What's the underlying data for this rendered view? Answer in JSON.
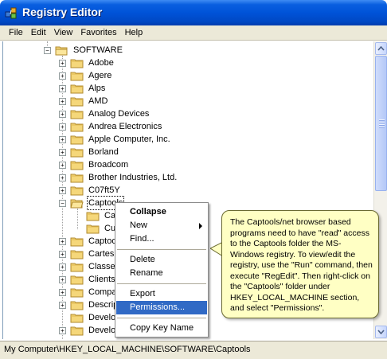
{
  "window": {
    "title": "Registry Editor"
  },
  "menu": [
    "File",
    "Edit",
    "View",
    "Favorites",
    "Help"
  ],
  "tree": {
    "root": "SOFTWARE",
    "items": [
      {
        "label": "Adobe",
        "expanded": false
      },
      {
        "label": "Agere",
        "expanded": false
      },
      {
        "label": "Alps",
        "expanded": false
      },
      {
        "label": "AMD",
        "expanded": false
      },
      {
        "label": "Analog Devices",
        "expanded": false
      },
      {
        "label": "Andrea Electronics",
        "expanded": false
      },
      {
        "label": "Apple Computer, Inc.",
        "expanded": false
      },
      {
        "label": "Borland",
        "expanded": false
      },
      {
        "label": "Broadcom",
        "expanded": false
      },
      {
        "label": "Brother Industries, Ltd.",
        "expanded": false
      },
      {
        "label": "C07ft5Y",
        "expanded": false
      },
      {
        "label": "Captools",
        "expanded": true,
        "selected": true
      },
      {
        "label": "Cap",
        "child": true
      },
      {
        "label": "Cur",
        "child": true
      },
      {
        "label": "Captoo",
        "expanded": false
      },
      {
        "label": "Cartesia",
        "expanded": false
      },
      {
        "label": "Classes",
        "expanded": false
      },
      {
        "label": "Clients",
        "expanded": false
      },
      {
        "label": "Compac",
        "expanded": false
      },
      {
        "label": "Descrip",
        "expanded": false
      },
      {
        "label": "Develop",
        "expanded": false,
        "no_expander": true
      },
      {
        "label": "Develop",
        "expanded": false
      }
    ]
  },
  "context_menu": {
    "items": [
      {
        "label": "Collapse",
        "bold": true
      },
      {
        "label": "New",
        "submenu": true
      },
      {
        "label": "Find..."
      },
      {
        "separator": true
      },
      {
        "label": "Delete"
      },
      {
        "label": "Rename"
      },
      {
        "separator": true
      },
      {
        "label": "Export"
      },
      {
        "label": "Permissions...",
        "highlighted": true
      },
      {
        "separator": true
      },
      {
        "label": "Copy Key Name"
      }
    ]
  },
  "callout": {
    "text": "The Captools/net browser based programs need to have \"read\" access to the Captools folder the MS-Windows registry. To view/edit the registry, use the \"Run\" command, then execute \"RegEdit\".  Then right-click on the \"Captools\" folder under HKEY_LOCAL_MACHINE section, and select \"Permissions\"."
  },
  "status": {
    "path": "My Computer\\HKEY_LOCAL_MACHINE\\SOFTWARE\\Captools"
  },
  "colors": {
    "titlebar": "#0053d8",
    "highlight": "#316ac5",
    "callout_bg": "#ffffc4",
    "chrome": "#ece9d8"
  }
}
